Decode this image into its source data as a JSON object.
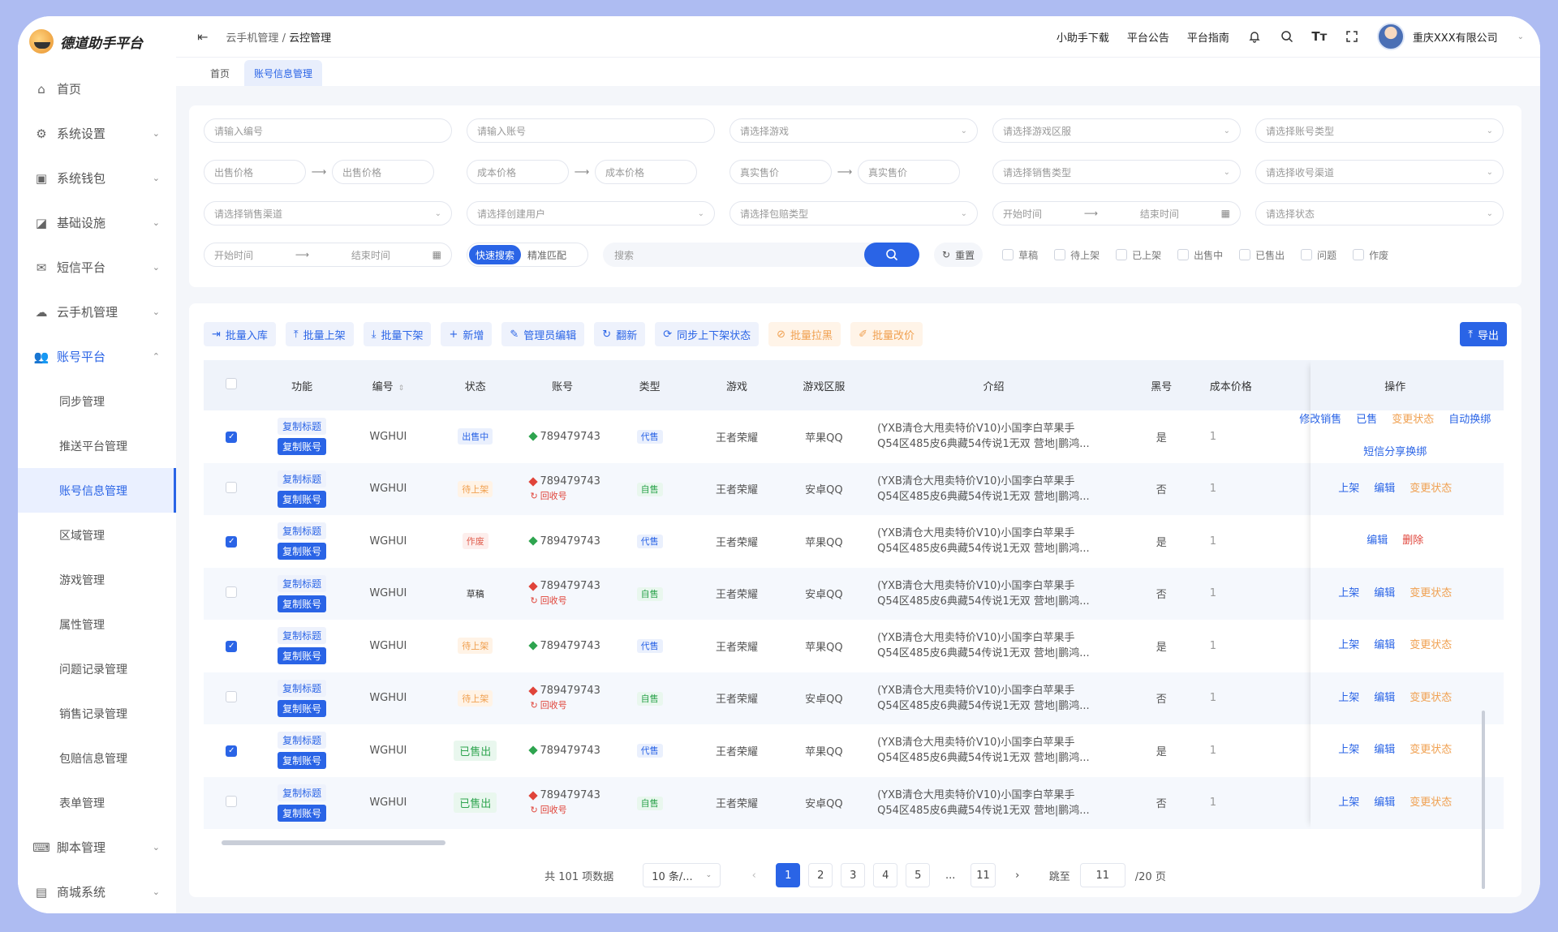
{
  "app": {
    "logo_text": "德道助手平台"
  },
  "sidebar": {
    "items": [
      {
        "label": "首页",
        "icon": "home-icon",
        "chevron": false
      },
      {
        "label": "系统设置",
        "icon": "gear-icon",
        "chevron": true
      },
      {
        "label": "系统钱包",
        "icon": "wallet-icon",
        "chevron": true
      },
      {
        "label": "基础设施",
        "icon": "chart-icon",
        "chevron": true
      },
      {
        "label": "短信平台",
        "icon": "message-icon",
        "chevron": true
      },
      {
        "label": "云手机管理",
        "icon": "cloud-icon",
        "chevron": true
      },
      {
        "label": "账号平台",
        "icon": "users-icon",
        "chevron": true,
        "open": true
      }
    ],
    "subitems": [
      "同步管理",
      "推送平台管理",
      "账号信息管理",
      "区域管理",
      "游戏管理",
      "属性管理",
      "问题记录管理",
      "销售记录管理",
      "包赔信息管理",
      "表单管理"
    ],
    "active_sub": "账号信息管理",
    "bottom_items": [
      {
        "label": "脚本管理",
        "icon": "code-icon"
      },
      {
        "label": "商城系统",
        "icon": "shop-icon"
      }
    ]
  },
  "header": {
    "breadcrumb": [
      "云手机管理",
      "云控管理"
    ],
    "links": [
      "小助手下载",
      "平台公告",
      "平台指南"
    ],
    "company": "重庆XXX有限公司"
  },
  "tabs": [
    "首页",
    "账号信息管理"
  ],
  "filters": {
    "row1": [
      "请输入编号",
      "请输入账号",
      "请选择游戏",
      "请选择游戏区服",
      "请选择账号类型"
    ],
    "row2_pairs": [
      [
        "出售价格",
        "出售价格"
      ],
      [
        "成本价格",
        "成本价格"
      ],
      [
        "真实售价",
        "真实售价"
      ]
    ],
    "row2_selects": [
      "请选择销售类型",
      "请选择收号渠道"
    ],
    "row3": [
      "请选择销售渠道",
      "请选择创建用户",
      "请选择包赔类型"
    ],
    "row3_range": {
      "start": "开始时间",
      "end": "结束时间"
    },
    "row3_select": "请选择状态",
    "row4_range": {
      "start": "开始时间",
      "end": "结束时间"
    },
    "search_modes": [
      "快速搜索",
      "精准匹配"
    ],
    "search_placeholder": "搜索",
    "reset_label": "重置",
    "status_checks": [
      "草稿",
      "待上架",
      "已上架",
      "出售中",
      "已售出",
      "问题",
      "作废"
    ]
  },
  "toolbar": {
    "buttons": [
      {
        "label": "批量入库",
        "icon": "import-icon",
        "style": "blue"
      },
      {
        "label": "批量上架",
        "icon": "upload-icon",
        "style": "blue"
      },
      {
        "label": "批量下架",
        "icon": "download-icon",
        "style": "blue"
      },
      {
        "label": "新增",
        "icon": "plus-icon",
        "style": "blue"
      },
      {
        "label": "管理员编辑",
        "icon": "pen-icon",
        "style": "blue"
      },
      {
        "label": "翻新",
        "icon": "refresh-icon",
        "style": "blue"
      },
      {
        "label": "同步上下架状态",
        "icon": "sync-icon",
        "style": "blue"
      },
      {
        "label": "批量拉黑",
        "icon": "ban-icon",
        "style": "orange"
      },
      {
        "label": "批量改价",
        "icon": "edit-icon",
        "style": "orange"
      }
    ],
    "export_label": "导出"
  },
  "table": {
    "columns": [
      "功能",
      "编号",
      "状态",
      "账号",
      "类型",
      "游戏",
      "游戏区服",
      "介绍",
      "黑号",
      "成本价格",
      "操作"
    ],
    "copy_title": "复制标题",
    "copy_account": "复制账号",
    "reclaim_label": "回收号",
    "rows": [
      {
        "checked": true,
        "id": "WGHUI",
        "status": "出售中",
        "status_kind": "sell",
        "account": "789479743",
        "account_kind": "g",
        "reclaim": false,
        "type": "代售",
        "type_kind": "dai",
        "game": "王者荣耀",
        "server": "苹果QQ",
        "intro1": "(YXB清仓大甩卖特价V10)小国李白苹果手",
        "intro2": "Q54区485皮6典藏54传说1无双 营地|鹏鸿...",
        "black": "是",
        "cost": "1",
        "ops": [
          [
            "修改销售",
            "blue"
          ],
          [
            "已售",
            "blue"
          ],
          [
            "变更状态",
            "orange"
          ],
          [
            "自动换绑",
            "blue"
          ],
          [
            "短信分享换绑",
            "blue"
          ]
        ]
      },
      {
        "checked": false,
        "id": "WGHUI",
        "status": "待上架",
        "status_kind": "wait",
        "account": "789479743",
        "account_kind": "r",
        "reclaim": true,
        "type": "自售",
        "type_kind": "zi",
        "game": "王者荣耀",
        "server": "安卓QQ",
        "intro1": "(YXB清仓大甩卖特价V10)小国李白苹果手",
        "intro2": "Q54区485皮6典藏54传说1无双 营地|鹏鸿...",
        "black": "否",
        "cost": "1",
        "ops": [
          [
            "上架",
            "blue"
          ],
          [
            "编辑",
            "blue"
          ],
          [
            "变更状态",
            "orange"
          ]
        ]
      },
      {
        "checked": true,
        "id": "WGHUI",
        "status": "作废",
        "status_kind": "void",
        "account": "789479743",
        "account_kind": "g",
        "reclaim": false,
        "type": "代售",
        "type_kind": "dai",
        "game": "王者荣耀",
        "server": "苹果QQ",
        "intro1": "(YXB清仓大甩卖特价V10)小国李白苹果手",
        "intro2": "Q54区485皮6典藏54传说1无双 营地|鹏鸿...",
        "black": "是",
        "cost": "1",
        "ops": [
          [
            "编辑",
            "blue"
          ],
          [
            "删除",
            "red"
          ]
        ]
      },
      {
        "checked": false,
        "id": "WGHUI",
        "status": "草稿",
        "status_kind": "draft",
        "account": "789479743",
        "account_kind": "r",
        "reclaim": true,
        "type": "自售",
        "type_kind": "zi",
        "game": "王者荣耀",
        "server": "安卓QQ",
        "intro1": "(YXB清仓大甩卖特价V10)小国李白苹果手",
        "intro2": "Q54区485皮6典藏54传说1无双 营地|鹏鸿...",
        "black": "否",
        "cost": "1",
        "ops": [
          [
            "上架",
            "blue"
          ],
          [
            "编辑",
            "blue"
          ],
          [
            "变更状态",
            "orange"
          ]
        ]
      },
      {
        "checked": true,
        "id": "WGHUI",
        "status": "待上架",
        "status_kind": "wait",
        "account": "789479743",
        "account_kind": "g",
        "reclaim": false,
        "type": "代售",
        "type_kind": "dai",
        "game": "王者荣耀",
        "server": "苹果QQ",
        "intro1": "(YXB清仓大甩卖特价V10)小国李白苹果手",
        "intro2": "Q54区485皮6典藏54传说1无双 营地|鹏鸿...",
        "black": "是",
        "cost": "1",
        "ops": [
          [
            "上架",
            "blue"
          ],
          [
            "编辑",
            "blue"
          ],
          [
            "变更状态",
            "orange"
          ]
        ]
      },
      {
        "checked": false,
        "id": "WGHUI",
        "status": "待上架",
        "status_kind": "wait",
        "account": "789479743",
        "account_kind": "r",
        "reclaim": true,
        "type": "自售",
        "type_kind": "zi",
        "game": "王者荣耀",
        "server": "安卓QQ",
        "intro1": "(YXB清仓大甩卖特价V10)小国李白苹果手",
        "intro2": "Q54区485皮6典藏54传说1无双 营地|鹏鸿...",
        "black": "否",
        "cost": "1",
        "ops": [
          [
            "上架",
            "blue"
          ],
          [
            "编辑",
            "blue"
          ],
          [
            "变更状态",
            "orange"
          ]
        ]
      },
      {
        "checked": true,
        "id": "WGHUI",
        "status": "已售出",
        "status_kind": "sold",
        "account": "789479743",
        "account_kind": "g",
        "reclaim": false,
        "type": "代售",
        "type_kind": "dai",
        "game": "王者荣耀",
        "server": "苹果QQ",
        "intro1": "(YXB清仓大甩卖特价V10)小国李白苹果手",
        "intro2": "Q54区485皮6典藏54传说1无双 营地|鹏鸿...",
        "black": "是",
        "cost": "1",
        "ops": [
          [
            "上架",
            "blue"
          ],
          [
            "编辑",
            "blue"
          ],
          [
            "变更状态",
            "orange"
          ]
        ]
      },
      {
        "checked": false,
        "id": "WGHUI",
        "status": "已售出",
        "status_kind": "sold",
        "account": "789479743",
        "account_kind": "r",
        "reclaim": true,
        "type": "自售",
        "type_kind": "zi",
        "game": "王者荣耀",
        "server": "安卓QQ",
        "intro1": "(YXB清仓大甩卖特价V10)小国李白苹果手",
        "intro2": "Q54区485皮6典藏54传说1无双 营地|鹏鸿...",
        "black": "否",
        "cost": "1",
        "ops": [
          [
            "上架",
            "blue"
          ],
          [
            "编辑",
            "blue"
          ],
          [
            "变更状态",
            "orange"
          ]
        ]
      }
    ]
  },
  "pagination": {
    "total_text": "共 101 项数据",
    "page_size": "10 条/...",
    "pages": [
      "1",
      "2",
      "3",
      "4",
      "5",
      "...",
      "11"
    ],
    "current": "1",
    "jump_label": "跳至",
    "jump_value": "11",
    "total_pages_text": "/20 页"
  },
  "colors": {
    "accent": "#2a64e6",
    "warning": "#f0a050",
    "danger": "#e0443a",
    "success": "#2ea44f"
  }
}
